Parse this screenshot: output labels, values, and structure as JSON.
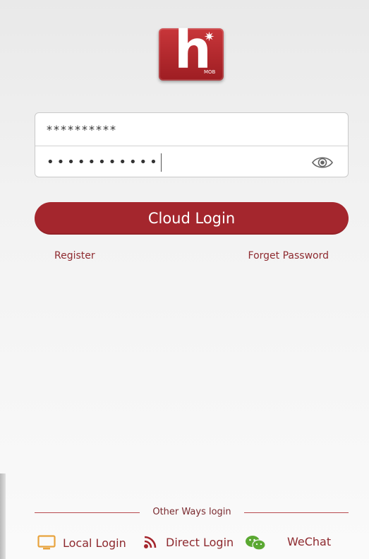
{
  "logo": {
    "letter": "h",
    "star": "✷",
    "sub": "MOB"
  },
  "username": {
    "value": "**********"
  },
  "password": {
    "value": "•••••••••••"
  },
  "login_button": {
    "label": "Cloud Login"
  },
  "links": {
    "register": "Register",
    "forget": "Forget Password"
  },
  "other": {
    "title": "Other Ways login",
    "local": "Local Login",
    "direct": "Direct Login",
    "wechat": "WeChat"
  },
  "colors": {
    "brand": "#a4262d",
    "icon_orange": "#e8a33d",
    "icon_green": "#5aa832"
  }
}
